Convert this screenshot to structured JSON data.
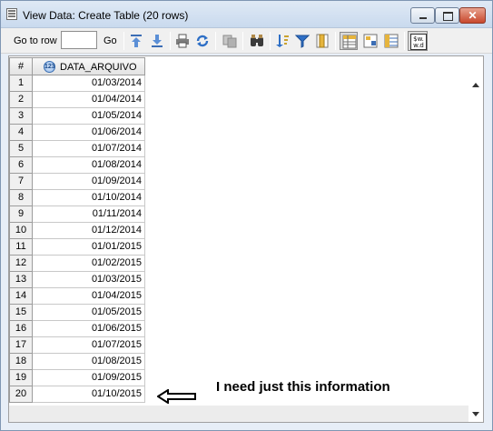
{
  "window": {
    "title": "View Data: Create Table (20 rows)",
    "close_glyph": "✕"
  },
  "toolbar": {
    "goto_label": "Go to row",
    "goto_value": "",
    "go_label": "Go",
    "icons": [
      "arrow-up-icon",
      "arrow-down-icon",
      "print-icon",
      "refresh-icon",
      "copy-icon",
      "binoculars-icon",
      "sort-icon",
      "filter-icon",
      "columns-icon",
      "grid-view-icon",
      "form-view-icon",
      "record-view-icon",
      "format-icon"
    ]
  },
  "grid": {
    "corner_label": "#",
    "column": {
      "type_icon": "numeric-type-icon",
      "type_glyph": "123",
      "label": "DATA_ARQUIVO"
    },
    "rows": [
      {
        "num": "1",
        "value": "01/03/2014"
      },
      {
        "num": "2",
        "value": "01/04/2014"
      },
      {
        "num": "3",
        "value": "01/05/2014"
      },
      {
        "num": "4",
        "value": "01/06/2014"
      },
      {
        "num": "5",
        "value": "01/07/2014"
      },
      {
        "num": "6",
        "value": "01/08/2014"
      },
      {
        "num": "7",
        "value": "01/09/2014"
      },
      {
        "num": "8",
        "value": "01/10/2014"
      },
      {
        "num": "9",
        "value": "01/11/2014"
      },
      {
        "num": "10",
        "value": "01/12/2014"
      },
      {
        "num": "11",
        "value": "01/01/2015"
      },
      {
        "num": "12",
        "value": "01/02/2015"
      },
      {
        "num": "13",
        "value": "01/03/2015"
      },
      {
        "num": "14",
        "value": "01/04/2015"
      },
      {
        "num": "15",
        "value": "01/05/2015"
      },
      {
        "num": "16",
        "value": "01/06/2015"
      },
      {
        "num": "17",
        "value": "01/07/2015"
      },
      {
        "num": "18",
        "value": "01/08/2015"
      },
      {
        "num": "19",
        "value": "01/09/2015"
      },
      {
        "num": "20",
        "value": "01/10/2015"
      }
    ]
  },
  "annotation": {
    "text": "I need just this information",
    "arrow_icon": "left-arrow-icon"
  }
}
